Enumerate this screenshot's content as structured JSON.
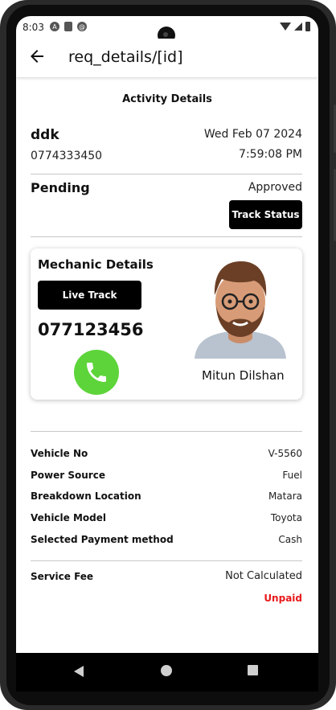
{
  "status_bar": {
    "time": "8:03"
  },
  "app_bar": {
    "title": "req_details/[id]"
  },
  "activity": {
    "section_title": "Activity Details",
    "customer_name": "ddk",
    "customer_phone": "0774333450",
    "date": "Wed Feb 07 2024",
    "time": "7:59:08 PM",
    "status": "Pending",
    "approval": "Approved",
    "track_button": "Track Status"
  },
  "mechanic": {
    "heading": "Mechanic Details",
    "live_track_button": "Live Track",
    "phone": "077123456",
    "name": "Mitun Dilshan"
  },
  "vehicle_details": [
    {
      "label": "Vehicle No",
      "value": "V-5560"
    },
    {
      "label": "Power Source",
      "value": "Fuel"
    },
    {
      "label": "Breakdown Location",
      "value": "Matara"
    },
    {
      "label": "Vehicle Model",
      "value": "Toyota"
    },
    {
      "label": "Selected Payment method",
      "value": "Cash"
    }
  ],
  "fee": {
    "label": "Service Fee",
    "value": "Not Calculated",
    "payment_status": "Unpaid"
  },
  "colors": {
    "call_green": "#5dd43a",
    "unpaid_red": "#e8191b",
    "button_black": "#000000"
  },
  "icons": [
    "back-arrow-icon",
    "phone-icon",
    "wifi-icon",
    "signal-icon",
    "battery-icon",
    "avatar"
  ]
}
